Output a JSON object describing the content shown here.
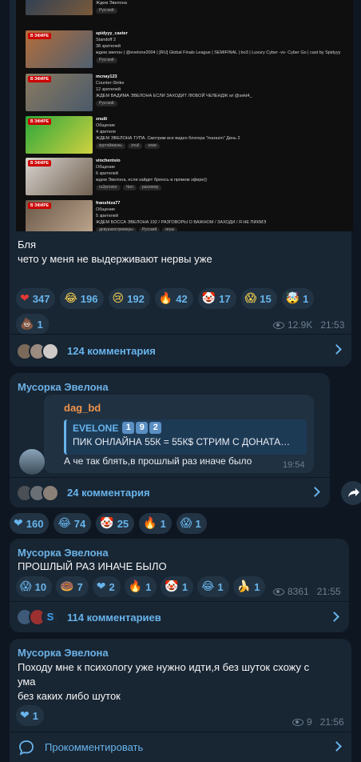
{
  "streams": [
    {
      "name": "",
      "game": "",
      "viewers": "",
      "title": "Ждем Эвелона",
      "tags": [
        "Русский"
      ],
      "colors": [
        "#1f3a5a",
        "#7a5a3a"
      ]
    },
    {
      "name": "spidyyy_caster",
      "game": "Standoff 2",
      "viewers": "38 зрителей",
      "title": "ждем эвелон | @evelone2004 | [RU] Global Finals League | SEMIFINAL | bo3 | Luxury Cyber -vs- Cyber Go | cast by Spidyyy",
      "tags": [
        "Русский"
      ],
      "colors": [
        "#b36d3a",
        "#506070"
      ]
    },
    {
      "name": "mcnay123",
      "game": "Counter-Strike",
      "viewers": "12 зрителей",
      "title": "ЖДЕМ ВАДИМА ЭВЕЛОНА ЕСЛИ ЗАХОДИТ ЛЮБОЙ ЧЕЛЕНДЖ w/ @sekt4_",
      "tags": [
        "Русский"
      ],
      "colors": [
        "#8a7a60",
        "#4a5a6a"
      ]
    },
    {
      "name": "znuili",
      "game": "Общение",
      "viewers": "4 зрителя",
      "title": "ЖДЕМ ЭВЕЛОНА ТУПА. Смотрим все видео блогера \"marazm\" День 2",
      "tags": [
        "крутойжизнь",
        "znuil",
        "www"
      ],
      "colors": [
        "#2aa83a",
        "#d0d040"
      ]
    },
    {
      "name": "vinchentsio",
      "game": "Общение",
      "viewers": "6 зрителей",
      "title": "ждем Эвелона, если зайдет бреюсь в прямом эфире))",
      "tags": [
        "ru2prostor",
        "Чил",
        "разговор"
      ],
      "colors": [
        "#d8d4d0",
        "#706050"
      ]
    },
    {
      "name": "franshiza77",
      "game": "Общение",
      "viewers": "5 зрителей",
      "title": "ЖДЕМ БОССА ЭВЕЛОНА 192 / РАЗГОВОРЫ О ВАЖНОМ / ЗАХОДИ / Я НЕ ПИКМЭ",
      "tags": [
        "девушкистримеры",
        "Русский",
        "игры"
      ],
      "colors": [
        "#6a5848",
        "#c0a890"
      ]
    }
  ],
  "live_label": "В ЭФИРЕ",
  "post1": {
    "text_line1": "Бля",
    "text_line2": "чето у меня не выдерживают нервы уже",
    "reactions": [
      {
        "icon": "heart-icon",
        "emoji": "❤",
        "count": "347",
        "color": "#e53935"
      },
      {
        "icon": "rofl-icon",
        "emoji": "😂",
        "count": "196",
        "color": "#ffd54f"
      },
      {
        "icon": "sad-icon",
        "emoji": "😢",
        "count": "192",
        "color": "#ffd54f"
      },
      {
        "icon": "fire-icon",
        "emoji": "🔥",
        "count": "42",
        "color": "#ff7043"
      },
      {
        "icon": "clown-icon",
        "emoji": "🤡",
        "count": "17",
        "color": "#ef5350"
      },
      {
        "icon": "scream-icon",
        "emoji": "😱",
        "count": "15",
        "color": "#ffd54f"
      },
      {
        "icon": "exploding-head-icon",
        "emoji": "🤯",
        "count": "1",
        "color": "#ffb74d"
      },
      {
        "icon": "poop-icon",
        "emoji": "💩",
        "count": "1",
        "color": "#8d6e63"
      }
    ],
    "views": "12.9K",
    "time": "21:53",
    "comments_label": "124 комментария"
  },
  "post2": {
    "sender": "Мусорка Эвелона",
    "quote_author": "dag_bd",
    "fwd_author": "EVELONE",
    "fwd_badges": [
      "1",
      "9",
      "2"
    ],
    "fwd_text": "ПИК ОНЛАЙНА 55К = 55К$  СТРИМ С ДОНАТА…",
    "text": "А че так блять,в прошлый раз иначе было",
    "time": "19:54",
    "comments_label": "24 комментария",
    "reactions": [
      {
        "icon": "heart-icon",
        "emoji": "❤",
        "count": "160"
      },
      {
        "icon": "rofl-icon",
        "emoji": "😂",
        "count": "74"
      },
      {
        "icon": "clown-icon",
        "emoji": "🤡",
        "count": "25"
      },
      {
        "icon": "fire-icon",
        "emoji": "🔥",
        "count": "1"
      },
      {
        "icon": "scream-icon",
        "emoji": "😱",
        "count": "1"
      }
    ]
  },
  "post3": {
    "sender": "Мусорка Эвелона",
    "text": "ПРОШЛЫЙ РАЗ ИНАЧЕ БЫЛО",
    "reactions": [
      {
        "icon": "scream-icon",
        "emoji": "😱",
        "count": "10"
      },
      {
        "icon": "star-face-icon",
        "emoji": "🍩",
        "count": "7"
      },
      {
        "icon": "heart-icon",
        "emoji": "❤",
        "count": "2"
      },
      {
        "icon": "fire-icon",
        "emoji": "🔥",
        "count": "1"
      },
      {
        "icon": "clown-icon",
        "emoji": "🤡",
        "count": "1"
      },
      {
        "icon": "rofl-icon",
        "emoji": "😂",
        "count": "1"
      },
      {
        "icon": "banana-icon",
        "emoji": "🍌",
        "count": "1"
      }
    ],
    "views": "8361",
    "time": "21:55",
    "comments_label": "114 комментариев"
  },
  "post4": {
    "sender": "Мусорка Эвелона",
    "text_line1": "Походу мне к психологу уже нужно идти,я без шуток схожу с",
    "text_line2": "ума",
    "text_line3": "без каких либо шуток",
    "reactions": [
      {
        "icon": "heart-icon",
        "emoji": "❤",
        "count": "1"
      }
    ],
    "views": "9",
    "time": "21:56",
    "comment_action": "Прокомментировать"
  },
  "colors": {
    "bg": "#0e1621",
    "bubble": "#182533",
    "accent": "#68b4ec",
    "sender": "#6cb2e6"
  }
}
